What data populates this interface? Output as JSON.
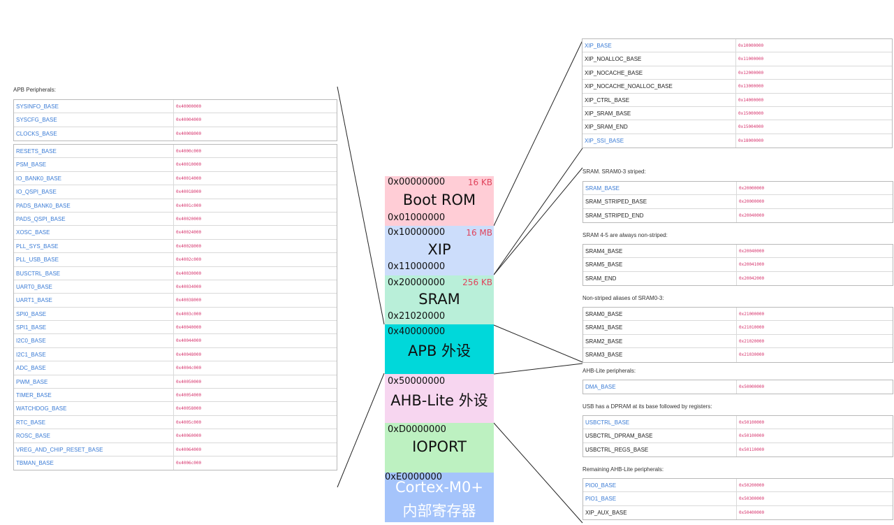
{
  "memory_map": [
    {
      "id": "boot-rom",
      "label": "Boot ROM",
      "start": "0x00000000",
      "end": "0x01000000",
      "size": "16 KB",
      "color": "#ffcdd6"
    },
    {
      "id": "xip",
      "label": "XIP",
      "start": "0x10000000",
      "end": "0x11000000",
      "size": "16 MB",
      "color": "#ccddfb"
    },
    {
      "id": "sram",
      "label": "SRAM",
      "start": "0x20000000",
      "end": "0x21020000",
      "size": "256 KB",
      "color": "#b9efd9"
    },
    {
      "id": "apb",
      "label": "APB 外设",
      "start": "0x40000000",
      "end": "",
      "size": "",
      "color": "#00d8da"
    },
    {
      "id": "ahb",
      "label": "AHB-Lite 外设",
      "start": "0x50000000",
      "end": "",
      "size": "",
      "color": "#f7d6f0"
    },
    {
      "id": "ioport",
      "label": "IOPORT",
      "start": "0xD0000000",
      "end": "",
      "size": "",
      "color": "#bdf1c1"
    },
    {
      "id": "cortex",
      "label_line1": "Cortex-M0+",
      "label_line2": "内部寄存器",
      "start": "0xE0000000",
      "end": "",
      "size": "",
      "color": "#a5c4fb"
    }
  ],
  "apb": {
    "caption": "APB Peripherals:",
    "group1": [
      {
        "name": "SYSINFO_BASE",
        "value": "0x40000000",
        "link": true
      },
      {
        "name": "SYSCFG_BASE",
        "value": "0x40004000",
        "link": true
      },
      {
        "name": "CLOCKS_BASE",
        "value": "0x40008000",
        "link": true
      }
    ],
    "group2": [
      {
        "name": "RESETS_BASE",
        "value": "0x4000c000",
        "link": true
      },
      {
        "name": "PSM_BASE",
        "value": "0x40010000",
        "link": true
      },
      {
        "name": "IO_BANK0_BASE",
        "value": "0x40014000",
        "link": true
      },
      {
        "name": "IO_QSPI_BASE",
        "value": "0x40018000",
        "link": true
      },
      {
        "name": "PADS_BANK0_BASE",
        "value": "0x4001c000",
        "link": true
      },
      {
        "name": "PADS_QSPI_BASE",
        "value": "0x40020000",
        "link": true
      },
      {
        "name": "XOSC_BASE",
        "value": "0x40024000",
        "link": true
      },
      {
        "name": "PLL_SYS_BASE",
        "value": "0x40028000",
        "link": true
      },
      {
        "name": "PLL_USB_BASE",
        "value": "0x4002c000",
        "link": true
      },
      {
        "name": "BUSCTRL_BASE",
        "value": "0x40030000",
        "link": true
      },
      {
        "name": "UART0_BASE",
        "value": "0x40034000",
        "link": true
      },
      {
        "name": "UART1_BASE",
        "value": "0x40038000",
        "link": true
      },
      {
        "name": "SPI0_BASE",
        "value": "0x4003c000",
        "link": true
      },
      {
        "name": "SPI1_BASE",
        "value": "0x40040000",
        "link": true
      },
      {
        "name": "I2C0_BASE",
        "value": "0x40044000",
        "link": true
      },
      {
        "name": "I2C1_BASE",
        "value": "0x40048000",
        "link": true
      },
      {
        "name": "ADC_BASE",
        "value": "0x4004c000",
        "link": true
      },
      {
        "name": "PWM_BASE",
        "value": "0x40050000",
        "link": true
      },
      {
        "name": "TIMER_BASE",
        "value": "0x40054000",
        "link": true
      },
      {
        "name": "WATCHDOG_BASE",
        "value": "0x40058000",
        "link": true
      },
      {
        "name": "RTC_BASE",
        "value": "0x4005c000",
        "link": true
      },
      {
        "name": "ROSC_BASE",
        "value": "0x40060000",
        "link": true
      },
      {
        "name": "VREG_AND_CHIP_RESET_BASE",
        "value": "0x40064000",
        "link": true
      },
      {
        "name": "TBMAN_BASE",
        "value": "0x4006c000",
        "link": true
      }
    ]
  },
  "xip_table": [
    {
      "name": "XIP_BASE",
      "value": "0x10000000",
      "link": true
    },
    {
      "name": "XIP_NOALLOC_BASE",
      "value": "0x11000000",
      "link": false
    },
    {
      "name": "XIP_NOCACHE_BASE",
      "value": "0x12000000",
      "link": false
    },
    {
      "name": "XIP_NOCACHE_NOALLOC_BASE",
      "value": "0x13000000",
      "link": false
    },
    {
      "name": "XIP_CTRL_BASE",
      "value": "0x14000000",
      "link": false
    },
    {
      "name": "XIP_SRAM_BASE",
      "value": "0x15000000",
      "link": false
    },
    {
      "name": "XIP_SRAM_END",
      "value": "0x15004000",
      "link": false
    },
    {
      "name": "XIP_SSI_BASE",
      "value": "0x18000000",
      "link": true
    }
  ],
  "sram_striped": {
    "caption": "SRAM. SRAM0-3 striped:",
    "rows": [
      {
        "name": "SRAM_BASE",
        "value": "0x20000000",
        "link": true
      },
      {
        "name": "SRAM_STRIPED_BASE",
        "value": "0x20000000",
        "link": false
      },
      {
        "name": "SRAM_STRIPED_END",
        "value": "0x20040000",
        "link": false
      }
    ]
  },
  "sram_nonstriped": {
    "caption": "SRAM 4-5 are always non-striped:",
    "rows": [
      {
        "name": "SRAM4_BASE",
        "value": "0x20040000",
        "link": false
      },
      {
        "name": "SRAM5_BASE",
        "value": "0x20041000",
        "link": false
      },
      {
        "name": "SRAM_END",
        "value": "0x20042000",
        "link": false
      }
    ]
  },
  "sram_aliases": {
    "caption": "Non-striped aliases of SRAM0-3:",
    "rows": [
      {
        "name": "SRAM0_BASE",
        "value": "0x21000000",
        "link": false
      },
      {
        "name": "SRAM1_BASE",
        "value": "0x21010000",
        "link": false
      },
      {
        "name": "SRAM2_BASE",
        "value": "0x21020000",
        "link": false
      },
      {
        "name": "SRAM3_BASE",
        "value": "0x21030000",
        "link": false
      }
    ]
  },
  "ahb_periph": {
    "caption": "AHB-Lite peripherals:",
    "rows": [
      {
        "name": "DMA_BASE",
        "value": "0x50000000",
        "link": true
      }
    ]
  },
  "usb": {
    "caption": "USB has a DPRAM at its base followed by registers:",
    "rows": [
      {
        "name": "USBCTRL_BASE",
        "value": "0x50100000",
        "link": true
      },
      {
        "name": "USBCTRL_DPRAM_BASE",
        "value": "0x50100000",
        "link": false
      },
      {
        "name": "USBCTRL_REGS_BASE",
        "value": "0x50110000",
        "link": false
      }
    ]
  },
  "remaining_ahb": {
    "caption": "Remaining AHB-Lite peripherals:",
    "rows": [
      {
        "name": "PIO0_BASE",
        "value": "0x50200000",
        "link": true
      },
      {
        "name": "PIO1_BASE",
        "value": "0x50300000",
        "link": true
      },
      {
        "name": "XIP_AUX_BASE",
        "value": "0x50400000",
        "link": false
      }
    ]
  }
}
